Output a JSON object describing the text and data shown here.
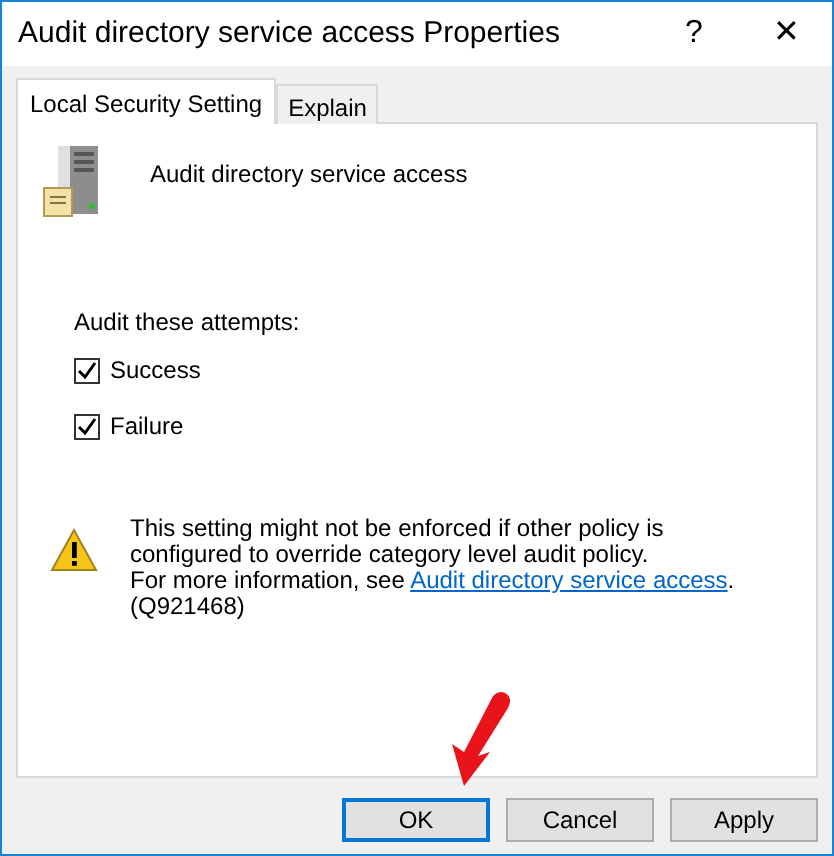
{
  "window": {
    "title": "Audit directory service access Properties",
    "help": "?",
    "close": "✕"
  },
  "tabs": [
    {
      "label": "Local Security Setting",
      "selected": true
    },
    {
      "label": "Explain",
      "selected": false
    }
  ],
  "policy": {
    "name": "Audit directory service access"
  },
  "attempts": {
    "label": "Audit these attempts:",
    "options": [
      {
        "label": "Success",
        "checked": true
      },
      {
        "label": "Failure",
        "checked": true
      }
    ]
  },
  "warning": {
    "text": "This setting might not be enforced if other policy is configured to override category level audit policy.",
    "more_prefix": "For more information, see ",
    "link": "Audit directory service access",
    "suffix": ". (Q921468)"
  },
  "buttons": [
    {
      "label": "OK",
      "default": true
    },
    {
      "label": "Cancel",
      "default": false
    },
    {
      "label": "Apply",
      "default": false
    }
  ]
}
